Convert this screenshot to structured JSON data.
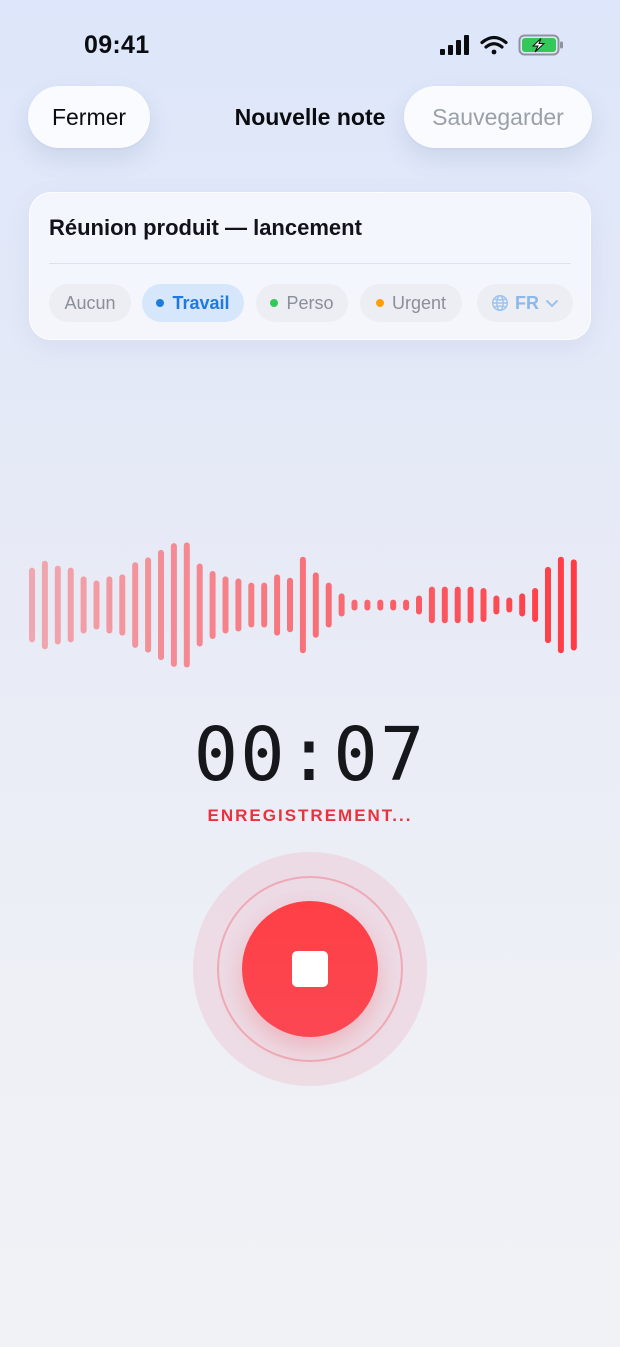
{
  "status_bar": {
    "time": "09:41"
  },
  "nav": {
    "close_label": "Fermer",
    "title": "Nouvelle note",
    "save_label": "Sauvegarder"
  },
  "note": {
    "title": "Réunion produit — lancement",
    "tags": [
      {
        "label": "Aucun",
        "selected": false
      },
      {
        "label": "Travail",
        "selected": true,
        "color": "#1f7ae0"
      },
      {
        "label": "Perso",
        "selected": false,
        "color": "#34c759"
      },
      {
        "label": "Urgent",
        "selected": false,
        "color": "#ff9f0a"
      }
    ],
    "language": {
      "label": "FR",
      "icon": "globe-icon"
    }
  },
  "recording": {
    "timer": "00:07",
    "status_label": "ENREGISTREMENT...",
    "accent_color": "#ff3b44",
    "waveform_levels": [
      0.55,
      0.65,
      0.58,
      0.55,
      0.42,
      0.36,
      0.42,
      0.45,
      0.63,
      0.7,
      0.81,
      0.91,
      0.92,
      0.61,
      0.5,
      0.42,
      0.39,
      0.33,
      0.33,
      0.45,
      0.4,
      0.71,
      0.48,
      0.33,
      0.17,
      0.08,
      0.08,
      0.08,
      0.08,
      0.08,
      0.14,
      0.27,
      0.27,
      0.27,
      0.27,
      0.25,
      0.14,
      0.11,
      0.17,
      0.25,
      0.56,
      0.71,
      0.67
    ]
  },
  "icons": {
    "signal": "signal-bars-icon",
    "wifi": "wifi-icon",
    "battery": "battery-charging-icon",
    "stop": "stop-icon"
  }
}
